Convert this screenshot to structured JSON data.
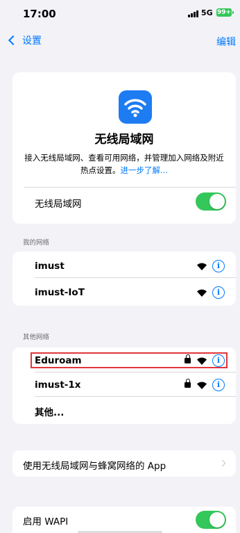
{
  "status_bar": {
    "time": "17:00",
    "network": "5G",
    "battery": "99+"
  },
  "nav": {
    "back_label": "设置",
    "edit_label": "编辑"
  },
  "hero": {
    "title": "无线局域网",
    "description": "接入无线局域网、查看可用网络，并管理加入网络及附近热点设置。",
    "learn_more": "进一步了解...",
    "wifi_label": "无线局域网"
  },
  "my_networks": {
    "header": "我的网络",
    "items": [
      {
        "name": "imust"
      },
      {
        "name": "imust-IoT"
      }
    ]
  },
  "other_networks": {
    "header": "其他网络",
    "items": [
      {
        "name": "Eduroam"
      },
      {
        "name": "imust-1x"
      }
    ],
    "other_label": "其他..."
  },
  "apps_row": {
    "label": "使用无线局域网与蜂窝网络的 App"
  },
  "wapi_row": {
    "label": "启用 WAPI"
  },
  "colors": {
    "accent": "#007aff",
    "toggle_on": "#34c759",
    "highlight": "#e0353b",
    "app_icon": "#1e7cf2"
  }
}
